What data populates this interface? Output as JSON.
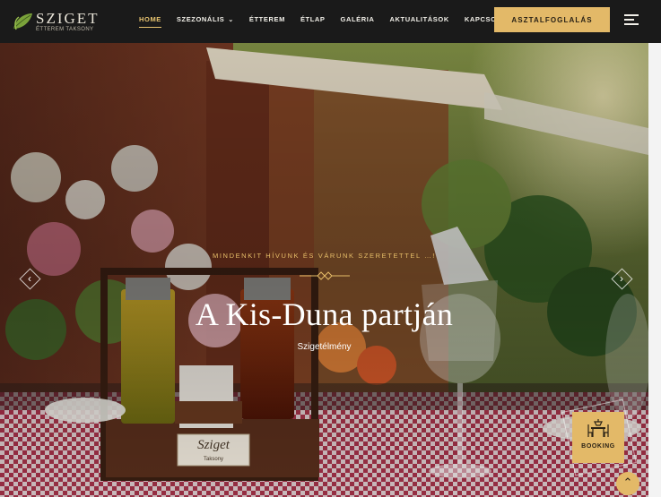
{
  "brand": {
    "title": "SZIGET",
    "subtitle": "ÉTTEREM TAKSONY"
  },
  "nav": {
    "items": [
      {
        "label": "HOME"
      },
      {
        "label": "SZEZONÁLIS"
      },
      {
        "label": "ÉTTEREM"
      },
      {
        "label": "ÉTLAP"
      },
      {
        "label": "GALÉRIA"
      },
      {
        "label": "AKTUALITÁSOK"
      },
      {
        "label": "KAPCSOLAT"
      }
    ],
    "cta_label": "ASZTALFOGLALÁS",
    "active": "HOME"
  },
  "hero": {
    "kicker": "MINDENKIT HÍVUNK ÉS VÁRUNK SZERETETTEL …!",
    "headline": "A Kis-Duna partján",
    "subline": "Szigetélmény",
    "prev_icon": "chevron-left-icon",
    "next_icon": "chevron-right-icon"
  },
  "booking": {
    "label": "BOOKING",
    "icon": "dining-table-icon"
  },
  "sign_text": {
    "line1": "Sziget",
    "line2": "Taksony"
  },
  "colors": {
    "accent": "#e3b968",
    "nav_bg": "#1a1a1a",
    "text_light": "#f1efe8"
  }
}
